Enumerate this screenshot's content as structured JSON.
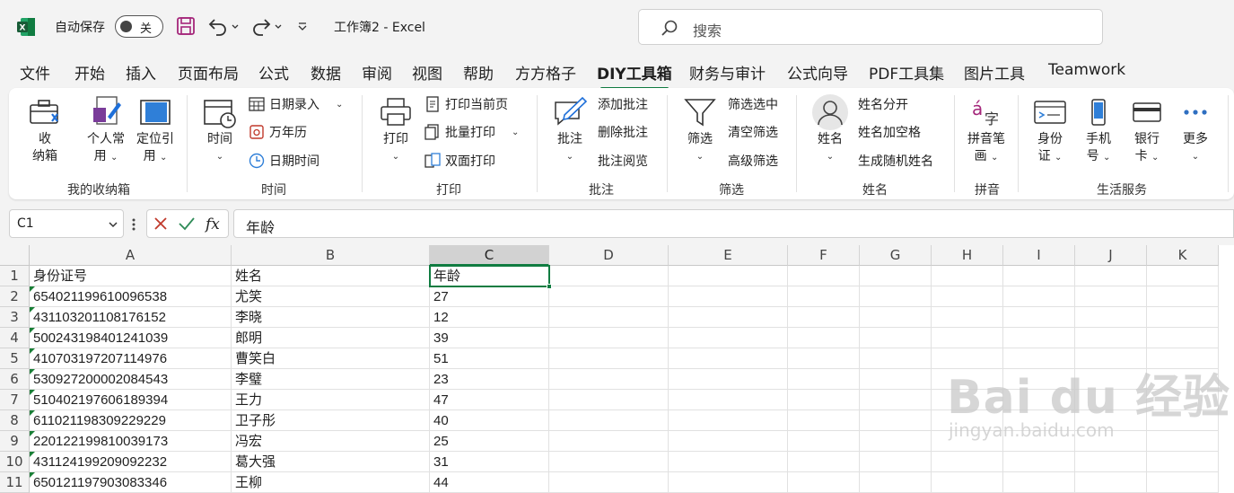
{
  "titlebar": {
    "autosave_label": "自动保存",
    "autosave_state": "关",
    "doc_title": "工作簿2 - Excel",
    "search_placeholder": "搜索"
  },
  "tabs": [
    "文件",
    "开始",
    "插入",
    "页面布局",
    "公式",
    "数据",
    "审阅",
    "视图",
    "帮助",
    "方方格子",
    "DIY工具箱",
    "财务与审计",
    "公式向导",
    "PDF工具集",
    "图片工具",
    "Teamwork"
  ],
  "active_tab": "DIY工具箱",
  "ribbon": {
    "groups": {
      "storage": {
        "label": "我的收纳箱",
        "btn_storage": "收\n纳箱",
        "btn_personal": "个人常\n用",
        "btn_locate": "定位引\n用"
      },
      "time": {
        "label": "时间",
        "btn_time": "时间",
        "date_entry": "日期录入",
        "calendar": "万年历",
        "datetime": "日期时间"
      },
      "print": {
        "label": "打印",
        "btn_print": "打印",
        "print_current": "打印当前页",
        "batch_print": "批量打印",
        "duplex_print": "双面打印"
      },
      "comment": {
        "label": "批注",
        "btn_comment": "批注",
        "add_comment": "添加批注",
        "delete_comment": "删除批注",
        "view_comment": "批注阅览"
      },
      "filter": {
        "label": "筛选",
        "btn_filter": "筛选",
        "filter_selected": "筛选选中",
        "clear_filter": "清空筛选",
        "advanced_filter": "高级筛选"
      },
      "name": {
        "label": "姓名",
        "btn_name": "姓名",
        "split_name": "姓名分开",
        "name_space": "姓名加空格",
        "random_name": "生成随机姓名"
      },
      "pinyin": {
        "label": "拼音",
        "btn_pinyin": "拼音笔\n画"
      },
      "life": {
        "label": "生活服务",
        "btn_id": "身份\n证",
        "btn_phone": "手机\n号",
        "btn_bank": "银行\n卡",
        "btn_more": "更多"
      }
    }
  },
  "formula_bar": {
    "name_box": "C1",
    "formula": "年龄"
  },
  "columns": [
    "A",
    "B",
    "C",
    "D",
    "E",
    "F",
    "G",
    "H",
    "I",
    "J",
    "K"
  ],
  "selected_column": "C",
  "rows": [
    {
      "num": "1",
      "a": "身份证号",
      "b": "姓名",
      "c": "年龄",
      "a_text": false
    },
    {
      "num": "2",
      "a": "654021199610096538",
      "b": "尤笑",
      "c": "27",
      "a_text": true
    },
    {
      "num": "3",
      "a": "431103201108176152",
      "b": "李晓",
      "c": "12",
      "a_text": true
    },
    {
      "num": "4",
      "a": "500243198401241039",
      "b": "郎明",
      "c": "39",
      "a_text": true
    },
    {
      "num": "5",
      "a": "410703197207114976",
      "b": "曹笑白",
      "c": "51",
      "a_text": true
    },
    {
      "num": "6",
      "a": "530927200002084543",
      "b": "李璧",
      "c": "23",
      "a_text": true
    },
    {
      "num": "7",
      "a": "510402197606189394",
      "b": "王力",
      "c": "47",
      "a_text": true
    },
    {
      "num": "8",
      "a": "611021198309229229",
      "b": "卫子彤",
      "c": "40",
      "a_text": true
    },
    {
      "num": "9",
      "a": "220122199810039173",
      "b": "冯宏",
      "c": "25",
      "a_text": true
    },
    {
      "num": "10",
      "a": "431124199209092232",
      "b": "葛大强",
      "c": "31",
      "a_text": true
    },
    {
      "num": "11",
      "a": "650121197903083346",
      "b": "王柳",
      "c": "44",
      "a_text": true
    }
  ],
  "watermark": {
    "main": "Bai du 经验",
    "sub": "jingyan.baidu.com"
  },
  "colors": {
    "excel_green": "#107c41",
    "text_marker": "#1a7f37"
  }
}
